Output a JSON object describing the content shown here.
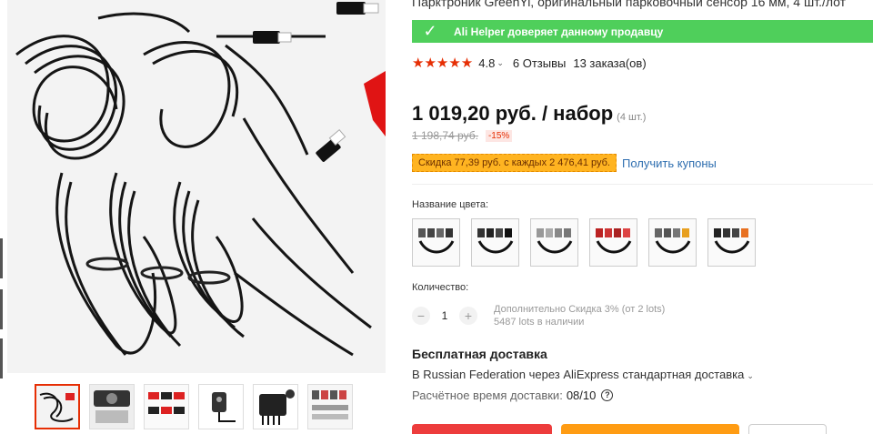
{
  "product": {
    "title": "Парктроник GreenYi, оригинальный парковочный сенсор 16 мм, 4 шт./лот",
    "trust_text": "Ali Helper доверяет данному продавцу",
    "rating": {
      "stars": "★★★★★",
      "value": "4.8",
      "reviews": "6 Отзывы",
      "orders": "13 заказа(ов)"
    },
    "price": {
      "current": "1 019,20 руб. / набор",
      "unit_note": "(4 шт.)",
      "old": "1 198,74 руб.",
      "discount": "-15%"
    },
    "coupon": {
      "badge": "Скидка 77,39 руб. с каждых 2 476,41 руб.",
      "link": "Получить купоны"
    },
    "color": {
      "label": "Название цвета:",
      "options": [
        "color-1",
        "color-2",
        "color-3",
        "color-4",
        "color-5",
        "color-6"
      ]
    },
    "quantity": {
      "label": "Количество:",
      "minus": "−",
      "value": "1",
      "plus": "+",
      "note_discount": "Дополнительно Скидка 3% (от 2 lots)",
      "note_stock": "5487 lots в наличии"
    },
    "shipping": {
      "title": "Бесплатная доставка",
      "detail": "В Russian Federation через AliExpress стандартная доставка",
      "eta_label": "Расчётное время доставки:",
      "eta_value": "08/10",
      "help_icon": "?"
    }
  },
  "gallery": {
    "thumbnails": [
      "thumb-1",
      "thumb-2",
      "thumb-3",
      "thumb-4",
      "thumb-5",
      "thumb-6"
    ],
    "active_index": 0
  },
  "colors": {
    "trust_green": "#4fcf5b",
    "accent_red": "#e62e04",
    "coupon_orange": "#ffb421",
    "link_blue": "#2f6fb0",
    "buy_red": "#ed3c3c",
    "cart_orange": "#ff9c13"
  }
}
